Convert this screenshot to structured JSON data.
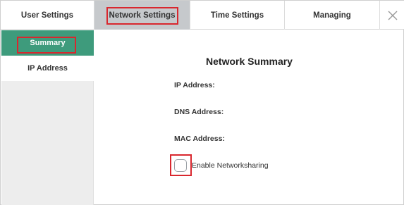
{
  "tabs": {
    "user_settings": "User Settings",
    "network_settings": "Network Settings",
    "time_settings": "Time Settings",
    "managing": "Managing",
    "close_glyph": "✕"
  },
  "sidebar": {
    "items": [
      {
        "label": "Summary",
        "active": true
      },
      {
        "label": "IP Address",
        "active": false
      }
    ]
  },
  "main": {
    "title": "Network Summary",
    "ip_label": "IP Address:",
    "dns_label": "DNS Address:",
    "mac_label": "MAC Address:",
    "checkbox_label": "Enable Networksharing",
    "checkbox_checked": false
  },
  "colors": {
    "active_tab_bg": "#c6c9cc",
    "sidebar_active_bg": "#3e9b7c",
    "highlight": "#d9272e"
  }
}
